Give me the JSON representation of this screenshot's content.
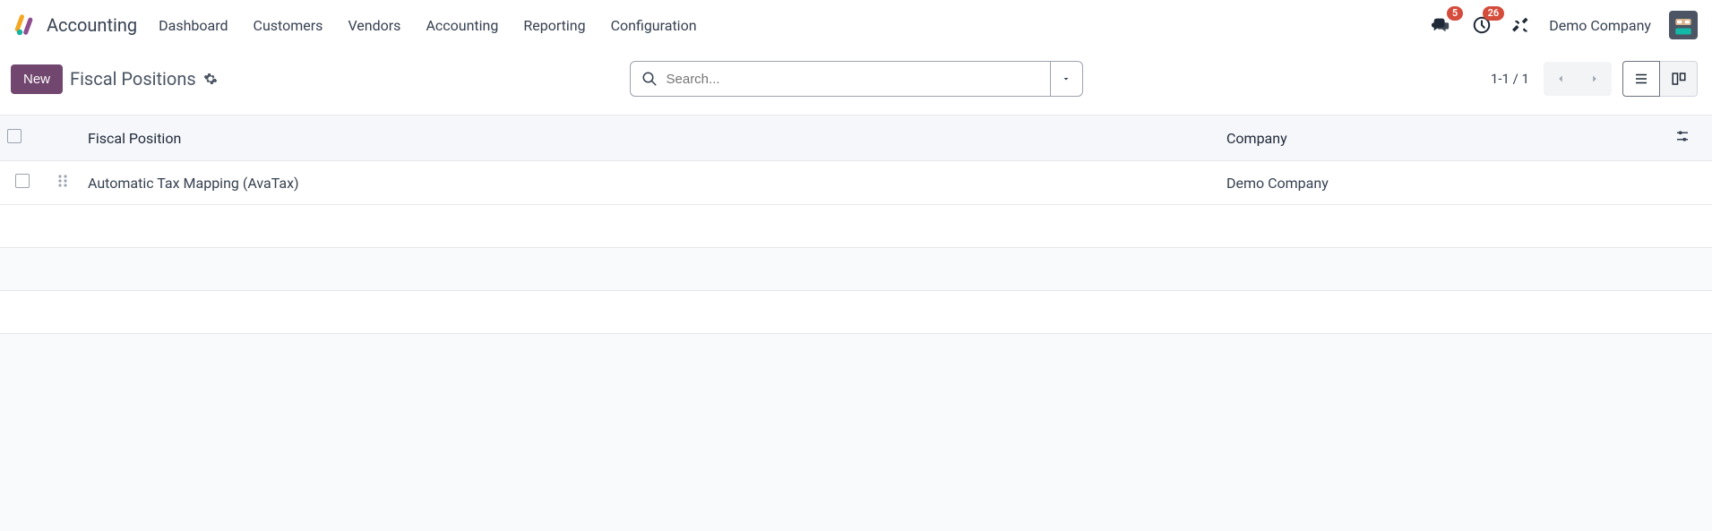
{
  "navbar": {
    "app_title": "Accounting",
    "menu": [
      "Dashboard",
      "Customers",
      "Vendors",
      "Accounting",
      "Reporting",
      "Configuration"
    ],
    "messages_badge": "5",
    "activities_badge": "26",
    "company": "Demo Company"
  },
  "control": {
    "new_label": "New",
    "breadcrumb": "Fiscal Positions",
    "search_placeholder": "Search...",
    "pager": "1-1 / 1"
  },
  "table": {
    "columns": {
      "fiscal_position": "Fiscal Position",
      "company": "Company"
    },
    "rows": [
      {
        "fiscal_position": "Automatic Tax Mapping (AvaTax)",
        "company": "Demo Company"
      }
    ]
  }
}
